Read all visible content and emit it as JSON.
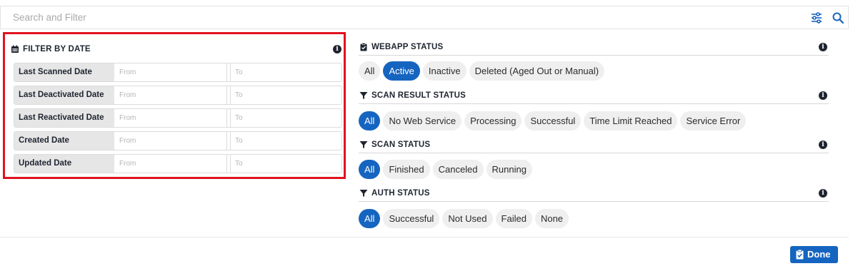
{
  "search": {
    "placeholder": "Search and Filter"
  },
  "date_filter": {
    "title": "FILTER BY DATE",
    "rows": [
      {
        "label": "Last Scanned Date",
        "from_placeholder": "From",
        "to_placeholder": "To"
      },
      {
        "label": "Last Deactivated Date",
        "from_placeholder": "From",
        "to_placeholder": "To"
      },
      {
        "label": "Last Reactivated Date",
        "from_placeholder": "From",
        "to_placeholder": "To"
      },
      {
        "label": "Created Date",
        "from_placeholder": "From",
        "to_placeholder": "To"
      },
      {
        "label": "Updated Date",
        "from_placeholder": "From",
        "to_placeholder": "To"
      }
    ]
  },
  "webapp_status": {
    "title": "WEBAPP STATUS",
    "options": [
      "All",
      "Active",
      "Inactive",
      "Deleted (Aged Out or Manual)"
    ],
    "selected": "Active"
  },
  "scan_result_status": {
    "title": "SCAN RESULT STATUS",
    "options": [
      "All",
      "No Web Service",
      "Processing",
      "Successful",
      "Time Limit Reached",
      "Service Error"
    ],
    "selected": "All"
  },
  "scan_status": {
    "title": "SCAN STATUS",
    "options": [
      "All",
      "Finished",
      "Canceled",
      "Running"
    ],
    "selected": "All"
  },
  "auth_status": {
    "title": "AUTH STATUS",
    "options": [
      "All",
      "Successful",
      "Not Used",
      "Failed",
      "None"
    ],
    "selected": "All"
  },
  "footer": {
    "done_label": "Done"
  },
  "colors": {
    "accent": "#1565c0",
    "highlight_border": "#e0121f",
    "chip_bg": "#efefef"
  }
}
